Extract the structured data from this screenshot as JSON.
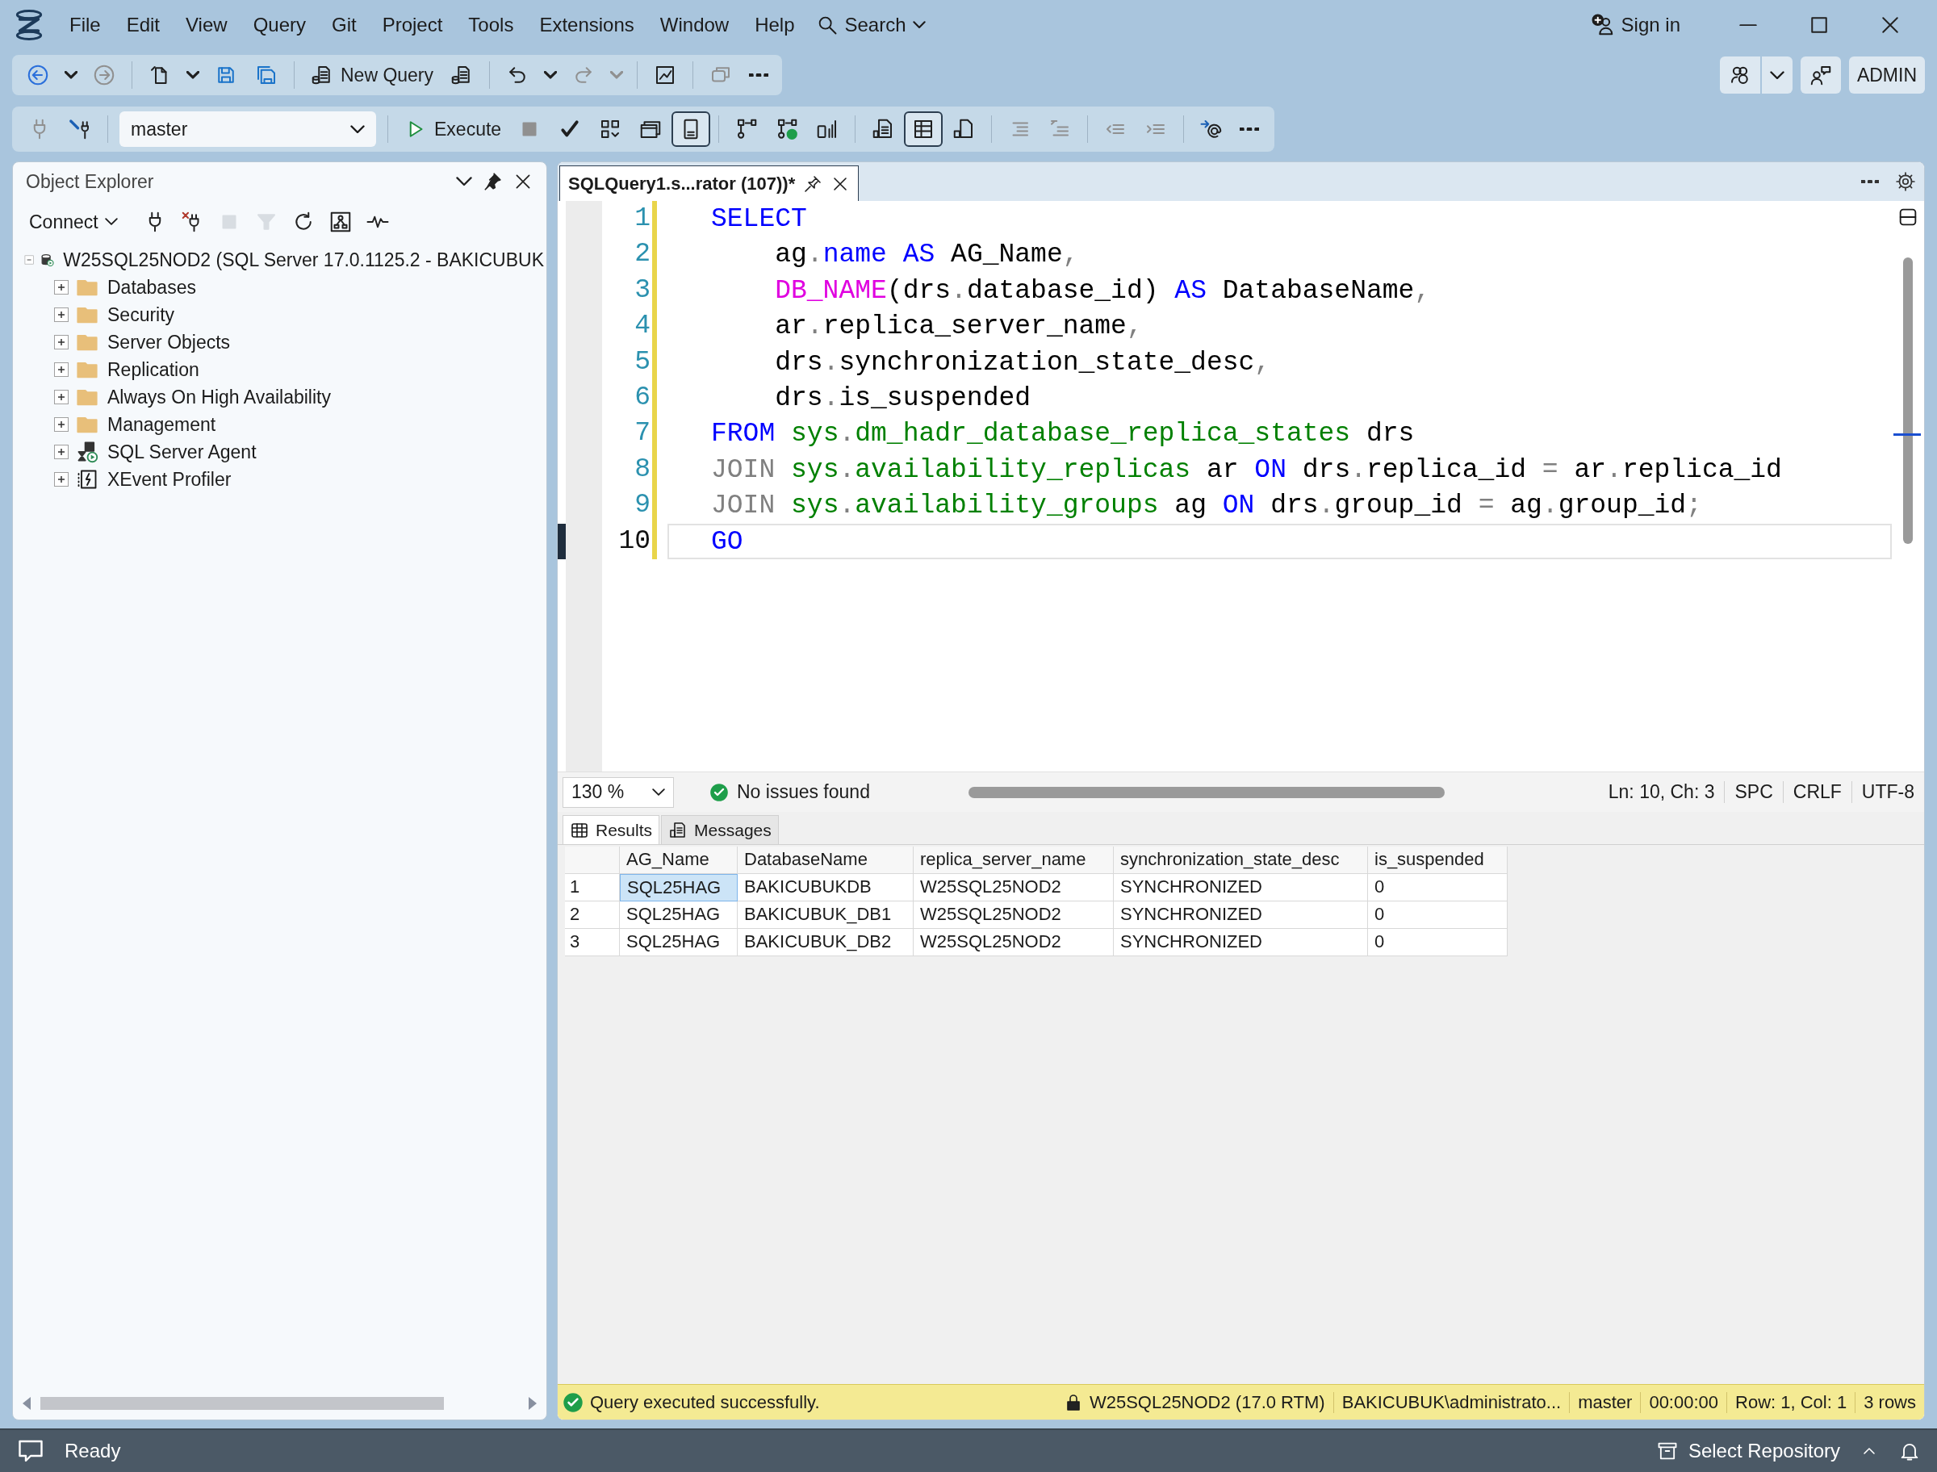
{
  "menu_bar": {
    "items": [
      "File",
      "Edit",
      "View",
      "Query",
      "Git",
      "Project",
      "Tools",
      "Extensions",
      "Window",
      "Help"
    ],
    "search": "Search",
    "sign_in": "Sign in"
  },
  "standard_toolbar": [
    {
      "kind": "back",
      "disabled": false
    },
    {
      "kind": "caret",
      "disabled": false
    },
    {
      "kind": "forward",
      "disabled": true
    },
    {
      "kind": "separator"
    },
    {
      "kind": "new-item",
      "disabled": false
    },
    {
      "kind": "caret",
      "disabled": false
    },
    {
      "kind": "save",
      "disabled": false
    },
    {
      "kind": "save-all",
      "disabled": false
    },
    {
      "kind": "separator"
    },
    {
      "kind": "new-query",
      "label": "New Query",
      "disabled": false
    },
    {
      "kind": "query-file",
      "disabled": false
    },
    {
      "kind": "separator"
    },
    {
      "kind": "undo",
      "disabled": false
    },
    {
      "kind": "caret",
      "disabled": false
    },
    {
      "kind": "redo",
      "disabled": true
    },
    {
      "kind": "caret",
      "disabled": true
    },
    {
      "kind": "separator"
    },
    {
      "kind": "monitor",
      "disabled": false
    },
    {
      "kind": "separator"
    },
    {
      "kind": "window",
      "disabled": true
    },
    {
      "kind": "more",
      "disabled": false
    }
  ],
  "account_buttons": [
    {
      "kind": "copilot"
    },
    {
      "kind": "caret"
    },
    {
      "kind": "feedback"
    },
    {
      "kind": "text",
      "label": "ADMIN"
    }
  ],
  "sql_toolbar": [
    {
      "kind": "plug",
      "disabled": true,
      "on": false
    },
    {
      "kind": "change-connection",
      "disabled": false,
      "on": false
    },
    {
      "kind": "separator"
    },
    {
      "kind": "database",
      "value": "master"
    },
    {
      "kind": "separator"
    },
    {
      "kind": "execute",
      "label": "Execute",
      "disabled": false,
      "on": false
    },
    {
      "kind": "stop",
      "disabled": true,
      "on": false
    },
    {
      "kind": "check",
      "disabled": false,
      "on": false
    },
    {
      "kind": "flowchart",
      "disabled": false,
      "on": false
    },
    {
      "kind": "windows",
      "disabled": false,
      "on": false
    },
    {
      "kind": "panel",
      "disabled": false,
      "on": true
    },
    {
      "kind": "separator"
    },
    {
      "kind": "plan",
      "disabled": false,
      "on": false
    },
    {
      "kind": "plan-check",
      "disabled": false,
      "on": false
    },
    {
      "kind": "stats",
      "disabled": false,
      "on": false
    },
    {
      "kind": "separator"
    },
    {
      "kind": "text-results",
      "disabled": false,
      "on": false
    },
    {
      "kind": "grid-results",
      "disabled": false,
      "on": true
    },
    {
      "kind": "file-results",
      "disabled": false,
      "on": false
    },
    {
      "kind": "separator"
    },
    {
      "kind": "comment",
      "disabled": true,
      "on": false
    },
    {
      "kind": "uncomment",
      "disabled": true,
      "on": false
    },
    {
      "kind": "separator"
    },
    {
      "kind": "outdent",
      "disabled": true,
      "on": false
    },
    {
      "kind": "indent",
      "disabled": true,
      "on": false
    },
    {
      "kind": "separator"
    },
    {
      "kind": "parameters",
      "disabled": false,
      "on": false
    },
    {
      "kind": "more",
      "disabled": false,
      "on": false
    }
  ],
  "object_explorer": {
    "title": "Object Explorer",
    "connect": "Connect",
    "toolbar": [
      {
        "kind": "plug",
        "disabled": false
      },
      {
        "kind": "disconnect",
        "disabled": false
      },
      {
        "kind": "stop",
        "disabled": true
      },
      {
        "kind": "filter",
        "disabled": true
      },
      {
        "kind": "refresh",
        "disabled": false
      },
      {
        "kind": "diagram",
        "disabled": false
      },
      {
        "kind": "pulse",
        "disabled": false
      }
    ],
    "tree": [
      {
        "label": "W25SQL25NOD2 (SQL Server 17.0.1125.2 - BAKICUBUK",
        "kind": "server",
        "expanded": true,
        "children": [
          {
            "label": "Databases",
            "kind": "folder",
            "expanded": false
          },
          {
            "label": "Security",
            "kind": "folder",
            "expanded": false
          },
          {
            "label": "Server Objects",
            "kind": "folder",
            "expanded": false
          },
          {
            "label": "Replication",
            "kind": "folder",
            "expanded": false
          },
          {
            "label": "Always On High Availability",
            "kind": "folder",
            "expanded": false
          },
          {
            "label": "Management",
            "kind": "folder",
            "expanded": false
          },
          {
            "label": "SQL Server Agent",
            "kind": "agent",
            "expanded": false
          },
          {
            "label": "XEvent Profiler",
            "kind": "profiler",
            "expanded": false
          }
        ]
      }
    ]
  },
  "editor": {
    "tab": {
      "title": "SQLQuery1.s...rator (107))*",
      "selected": true
    },
    "lines": [
      {
        "number": "1",
        "current": false,
        "tokens": [
          {
            "text": "SELECT",
            "kind": "keyword"
          }
        ]
      },
      {
        "number": "2",
        "current": false,
        "tokens": [
          {
            "text": "    ag",
            "kind": "plain"
          },
          {
            "text": ".",
            "kind": "operator"
          },
          {
            "text": "name",
            "kind": "keyword"
          },
          {
            "text": " AS",
            "kind": "keyword"
          },
          {
            "text": " AG_Name",
            "kind": "plain"
          },
          {
            "text": ",",
            "kind": "operator"
          }
        ]
      },
      {
        "number": "3",
        "current": false,
        "tokens": [
          {
            "text": "    DB_NAME",
            "kind": "function"
          },
          {
            "text": "(drs",
            "kind": "plain"
          },
          {
            "text": ".",
            "kind": "operator"
          },
          {
            "text": "database_id) ",
            "kind": "plain"
          },
          {
            "text": "AS",
            "kind": "keyword"
          },
          {
            "text": " DatabaseName",
            "kind": "plain"
          },
          {
            "text": ",",
            "kind": "operator"
          }
        ]
      },
      {
        "number": "4",
        "current": false,
        "tokens": [
          {
            "text": "    ar",
            "kind": "plain"
          },
          {
            "text": ".",
            "kind": "operator"
          },
          {
            "text": "replica_server_name",
            "kind": "plain"
          },
          {
            "text": ",",
            "kind": "operator"
          }
        ]
      },
      {
        "number": "5",
        "current": false,
        "tokens": [
          {
            "text": "    drs",
            "kind": "plain"
          },
          {
            "text": ".",
            "kind": "operator"
          },
          {
            "text": "synchronization_state_desc",
            "kind": "plain"
          },
          {
            "text": ",",
            "kind": "operator"
          }
        ]
      },
      {
        "number": "6",
        "current": false,
        "tokens": [
          {
            "text": "    drs",
            "kind": "plain"
          },
          {
            "text": ".",
            "kind": "operator"
          },
          {
            "text": "is_suspended",
            "kind": "plain"
          }
        ]
      },
      {
        "number": "7",
        "current": false,
        "tokens": [
          {
            "text": "FROM ",
            "kind": "keyword"
          },
          {
            "text": "sys",
            "kind": "system"
          },
          {
            "text": ".",
            "kind": "operator"
          },
          {
            "text": "dm_hadr_database_replica_states",
            "kind": "system"
          },
          {
            "text": " drs",
            "kind": "plain"
          }
        ]
      },
      {
        "number": "8",
        "current": false,
        "tokens": [
          {
            "text": "JOIN ",
            "kind": "operator"
          },
          {
            "text": "sys",
            "kind": "system"
          },
          {
            "text": ".",
            "kind": "operator"
          },
          {
            "text": "availability_replicas",
            "kind": "system"
          },
          {
            "text": " ar ",
            "kind": "plain"
          },
          {
            "text": "ON",
            "kind": "keyword"
          },
          {
            "text": " drs",
            "kind": "plain"
          },
          {
            "text": ".",
            "kind": "operator"
          },
          {
            "text": "replica_id ",
            "kind": "plain"
          },
          {
            "text": "=",
            "kind": "operator"
          },
          {
            "text": " ar",
            "kind": "plain"
          },
          {
            "text": ".",
            "kind": "operator"
          },
          {
            "text": "replica_id",
            "kind": "plain"
          }
        ]
      },
      {
        "number": "9",
        "current": false,
        "tokens": [
          {
            "text": "JOIN ",
            "kind": "operator"
          },
          {
            "text": "sys",
            "kind": "system"
          },
          {
            "text": ".",
            "kind": "operator"
          },
          {
            "text": "availability_groups",
            "kind": "system"
          },
          {
            "text": " ag ",
            "kind": "plain"
          },
          {
            "text": "ON",
            "kind": "keyword"
          },
          {
            "text": " drs",
            "kind": "plain"
          },
          {
            "text": ".",
            "kind": "operator"
          },
          {
            "text": "group_id ",
            "kind": "plain"
          },
          {
            "text": "=",
            "kind": "operator"
          },
          {
            "text": " ag",
            "kind": "plain"
          },
          {
            "text": ".",
            "kind": "operator"
          },
          {
            "text": "group_id",
            "kind": "plain"
          },
          {
            "text": ";",
            "kind": "operator"
          }
        ]
      },
      {
        "number": "10",
        "current": true,
        "tokens": [
          {
            "text": "GO",
            "kind": "keyword"
          }
        ]
      }
    ],
    "zoom": "130 %",
    "issues": "No issues found",
    "position": "Ln: 10, Ch: 3",
    "indentation": "SPC",
    "line_endings": "CRLF",
    "encoding": "UTF-8"
  },
  "results": {
    "tabs": [
      {
        "label": "Results",
        "kind": "grid",
        "selected": true
      },
      {
        "label": "Messages",
        "kind": "messages",
        "selected": false
      }
    ],
    "columns": [
      "AG_Name",
      "DatabaseName",
      "replica_server_name",
      "synchronization_state_desc",
      "is_suspended"
    ],
    "rows": [
      {
        "number": "1",
        "cells": [
          {
            "text": "SQL25HAG",
            "selected": true
          },
          {
            "text": "BAKICUBUKDB",
            "selected": false
          },
          {
            "text": "W25SQL25NOD2",
            "selected": false
          },
          {
            "text": "SYNCHRONIZED",
            "selected": false
          },
          {
            "text": "0",
            "selected": false
          }
        ]
      },
      {
        "number": "2",
        "cells": [
          {
            "text": "SQL25HAG",
            "selected": false
          },
          {
            "text": "BAKICUBUK_DB1",
            "selected": false
          },
          {
            "text": "W25SQL25NOD2",
            "selected": false
          },
          {
            "text": "SYNCHRONIZED",
            "selected": false
          },
          {
            "text": "0",
            "selected": false
          }
        ]
      },
      {
        "number": "3",
        "cells": [
          {
            "text": "SQL25HAG",
            "selected": false
          },
          {
            "text": "BAKICUBUK_DB2",
            "selected": false
          },
          {
            "text": "W25SQL25NOD2",
            "selected": false
          },
          {
            "text": "SYNCHRONIZED",
            "selected": false
          },
          {
            "text": "0",
            "selected": false
          }
        ]
      }
    ]
  },
  "query_status": {
    "message": "Query executed successfully.",
    "server": "W25SQL25NOD2 (17.0 RTM)",
    "user": "BAKICUBUK\\administrato...",
    "database": "master",
    "elapsed": "00:00:00",
    "position": "Row: 1, Col: 1",
    "rows": "3 rows"
  },
  "status_bar": {
    "message": "Ready",
    "repository": "Select Repository"
  }
}
